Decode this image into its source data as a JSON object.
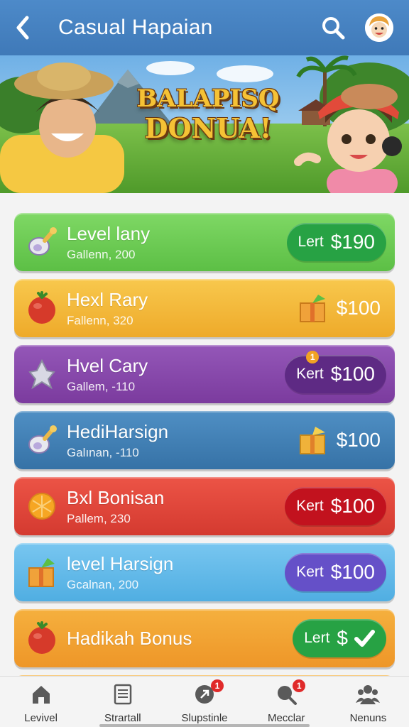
{
  "header": {
    "title": "Casual Hapaian",
    "back_icon": "chevron-left-icon",
    "search_icon": "search-icon",
    "avatar_icon": "avatar-icon"
  },
  "banner": {
    "line1": "BALAPISQ",
    "line2": "DONUA!"
  },
  "rewards": [
    {
      "title": "Level lany",
      "subtitle": "Gallenn, 200",
      "pill_label": "Lert",
      "price": "$190",
      "icon": "spoon-icon",
      "accent": "#6dcb52"
    },
    {
      "title": "Hexl Rary",
      "subtitle": "Fallenn, 320",
      "price": "$100",
      "icon": "tomato-icon",
      "accent": "#f3b43a"
    },
    {
      "title": "Hvel Cary",
      "subtitle": "Gallem, -110",
      "pill_label": "Kert",
      "price": "$100",
      "icon": "star-figure-icon",
      "accent": "#8546a8",
      "pill_badge": "1"
    },
    {
      "title": "HediHarsign",
      "subtitle": "Galınan, -110",
      "price": "$100",
      "icon": "spoon-icon",
      "accent": "#3f7fb2"
    },
    {
      "title": "Bxl Bonisan",
      "subtitle": "Pallem, 230",
      "pill_label": "Kert",
      "price": "$100",
      "icon": "orange-icon",
      "accent": "#e2473c"
    },
    {
      "title": "level Harsign",
      "subtitle": "Gcalnan, 200",
      "pill_label": "Kert",
      "price": "$100",
      "icon": "gift-box-icon",
      "accent": "#5db5e8"
    },
    {
      "title": "Hadikah Bonus",
      "subtitle": "",
      "pill_label": "Lert",
      "price": "$",
      "icon": "tomato-icon",
      "accent": "#f0a032"
    }
  ],
  "nav": [
    {
      "label": "Levivel",
      "icon": "home-icon"
    },
    {
      "label": "Strartall",
      "icon": "document-icon"
    },
    {
      "label": "Slupstinle",
      "icon": "pin-icon",
      "badge": "1"
    },
    {
      "label": "Mecclar",
      "icon": "search-icon",
      "badge": "1"
    },
    {
      "label": "Nenuns",
      "icon": "people-icon"
    }
  ]
}
